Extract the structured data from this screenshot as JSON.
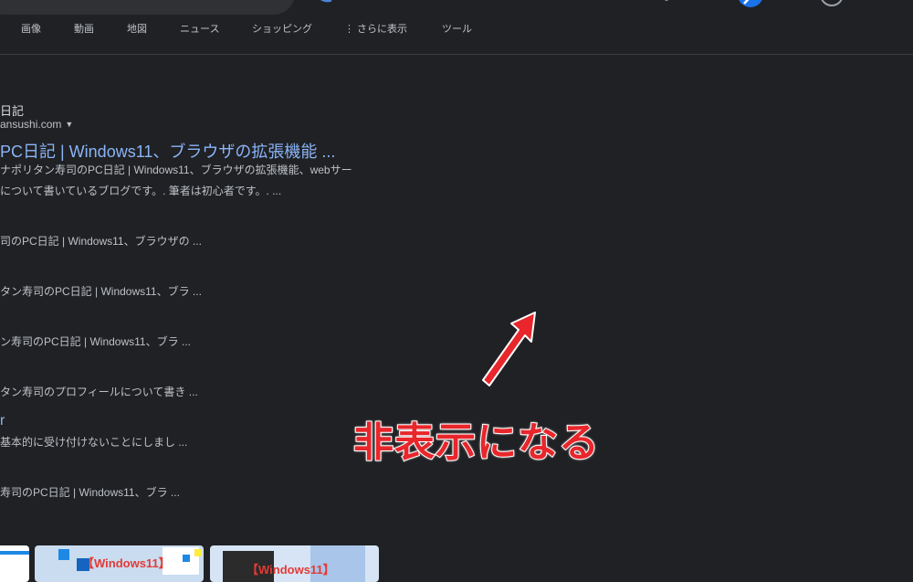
{
  "tabs": [
    "画像",
    "動画",
    "地図",
    "ニュース",
    "ショッピング",
    "⋮ さらに表示",
    "ツール"
  ],
  "result": {
    "site_name": "日記",
    "url": "ansushi.com",
    "title": "PC日記 | Windows11、ブラウザの拡張機能 ...",
    "snippet_line1": "ナポリタン寿司のPC日記 | Windows11、ブラウザの拡張機能、webサー",
    "snippet_line2": "について書いているブログです。. 筆者は初心者です。. ..."
  },
  "sitelinks": [
    "司のPC日記 | Windows11、ブラウザの ...",
    "タン寿司のPC日記 | Windows11、ブラ ...",
    "ン寿司のPC日記 | Windows11、ブラ ...",
    "タン寿司のプロフィールについて書き ...",
    "基本的に受け付けないことにしまし ...",
    "寿司のPC日記 | Windows11、ブラ ..."
  ],
  "sitelink_title": "r",
  "thumbnails": [
    {
      "label": ""
    },
    {
      "label": "【Windows11】"
    },
    {
      "label": "【Windows11】"
    }
  ],
  "annotation": {
    "text": "非表示になる",
    "color": "#e8262b"
  },
  "colors": {
    "background": "#202124",
    "link": "#8ab4f8",
    "text": "#bdc1c6"
  }
}
